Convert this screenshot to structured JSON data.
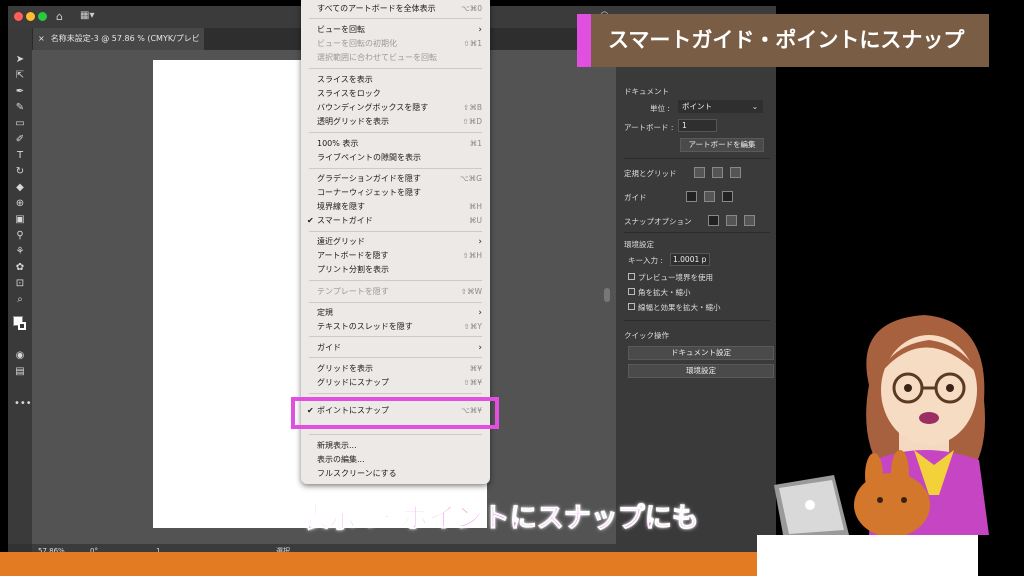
{
  "document": {
    "tab_label": "名称未設定-3 @ 57.86 % (CMYK/プレビュー)",
    "zoom": "57.86%",
    "rotation": "0°",
    "artboard_number": "1",
    "status_tool": "選択"
  },
  "view_menu": {
    "items": [
      {
        "label": "すべてのアートボードを全体表示",
        "shortcut": "⌥⌘0",
        "type": "partial"
      },
      {
        "label": "ビューを回転",
        "arrow": "›"
      },
      {
        "label": "ビューを回転の初期化",
        "shortcut": "⇧⌘1",
        "disabled": true
      },
      {
        "label": "選択範囲に合わせてビューを回転",
        "disabled": true
      },
      {
        "label": "スライスを表示"
      },
      {
        "label": "スライスをロック"
      },
      {
        "label": "バウンディングボックスを隠す",
        "shortcut": "⇧⌘B"
      },
      {
        "label": "透明グリッドを表示",
        "shortcut": "⇧⌘D"
      },
      {
        "label": "100% 表示",
        "shortcut": "⌘1"
      },
      {
        "label": "ライブペイントの隙間を表示"
      },
      {
        "label": "グラデーションガイドを隠す",
        "shortcut": "⌥⌘G"
      },
      {
        "label": "コーナーウィジェットを隠す"
      },
      {
        "label": "境界線を隠す",
        "shortcut": "⌘H"
      },
      {
        "label": "スマートガイド",
        "shortcut": "⌘U",
        "checked": true
      },
      {
        "label": "遠近グリッド",
        "arrow": "›"
      },
      {
        "label": "アートボードを隠す",
        "shortcut": "⇧⌘H"
      },
      {
        "label": "プリント分割を表示"
      },
      {
        "label": "テンプレートを隠す",
        "shortcut": "⇧⌘W",
        "disabled": true
      },
      {
        "label": "定規",
        "arrow": "›"
      },
      {
        "label": "テキストのスレッドを隠す",
        "shortcut": "⇧⌘Y"
      },
      {
        "label": "ガイド",
        "arrow": "›"
      },
      {
        "label": "グリッドを表示",
        "shortcut": "⌘¥"
      },
      {
        "label": "グリッドにスナップ",
        "shortcut": "⇧⌘¥"
      },
      {
        "label": "ポイントにスナップ",
        "shortcut": "⌥⌘¥",
        "checked": true
      },
      {
        "label": "新規表示..."
      },
      {
        "label": "表示の編集..."
      },
      {
        "label": "フルスクリーンにする"
      }
    ]
  },
  "properties_panel": {
    "document_heading": "ドキュメント",
    "unit_label": "単位 :",
    "unit_value": "ポイント",
    "artboard_label": "アートボード :",
    "artboard_value": "1",
    "edit_artboard_button": "アートボードを編集",
    "rulers_grids_label": "定規とグリッド",
    "guides_label": "ガイド",
    "snap_options_label": "スナップオプション",
    "preferences_heading": "環境設定",
    "key_increment_label": "キー入力 :",
    "key_increment_value": "1.0001 p",
    "preview_bounds": "プレビュー境界を使用",
    "scale_corners": "角を拡大・縮小",
    "scale_strokes": "線幅と効果を拡大・縮小",
    "quick_actions_heading": "クイック操作",
    "document_setup_button": "ドキュメント設定",
    "preferences_button": "環境設定"
  },
  "overlay": {
    "title": "スマートガイド・ポイントにスナップ",
    "caption": "表示 ＞ ポイントにスナップにも"
  },
  "colors": {
    "accent_magenta": "#e14fe0",
    "title_brown": "#7a5d45",
    "strip_orange": "#e37b22"
  }
}
